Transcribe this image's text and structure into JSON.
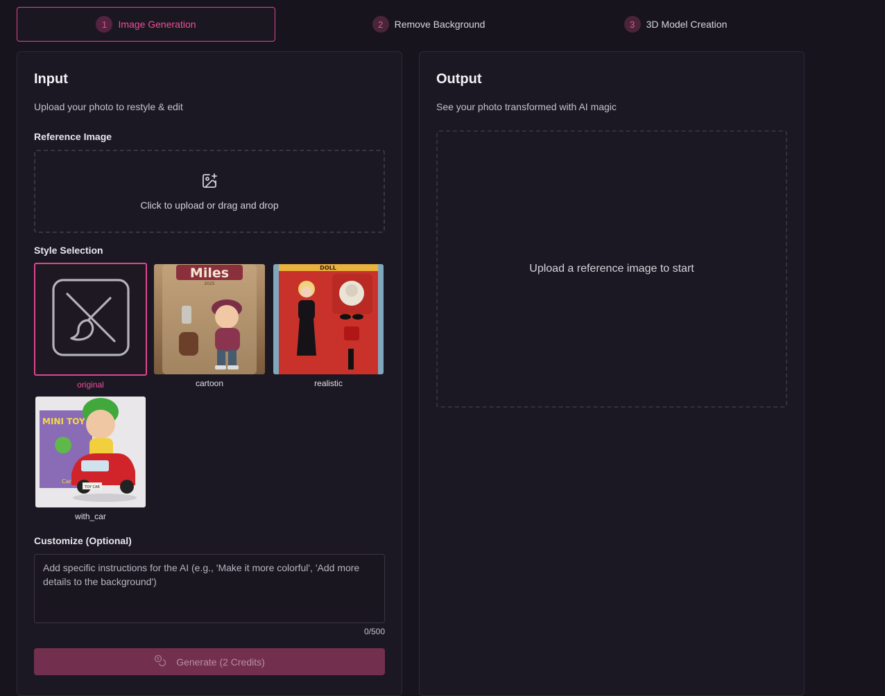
{
  "steps": [
    {
      "num": "1",
      "label": "Image Generation"
    },
    {
      "num": "2",
      "label": "Remove Background"
    },
    {
      "num": "3",
      "label": "3D Model Creation"
    }
  ],
  "input": {
    "title": "Input",
    "subtitle": "Upload your photo to restyle & edit",
    "reference_label": "Reference Image",
    "upload_text": "Click to upload or drag and drop",
    "upload_icon": "image-plus-icon",
    "style_label": "Style Selection",
    "styles": [
      {
        "name": "original",
        "selected": true
      },
      {
        "name": "cartoon",
        "selected": false,
        "box_text": "Miles",
        "box_year": "2025"
      },
      {
        "name": "realistic",
        "selected": false,
        "box_text": "DOLL"
      },
      {
        "name": "with_car",
        "selected": false,
        "box_text": "MINI TOY",
        "box_side": "Car Bu",
        "plate": "TOY CAR"
      }
    ],
    "customize_label": "Customize (Optional)",
    "customize_placeholder": "Add specific instructions for the AI (e.g., 'Make it more colorful', 'Add more details to the background')",
    "counter": "0/500",
    "generate_label": "Generate (2 Credits)",
    "generate_icon": "coins-icon"
  },
  "output": {
    "title": "Output",
    "subtitle": "See your photo transformed with AI magic",
    "placeholder": "Upload a reference image to start"
  },
  "colors": {
    "accent": "#e0458f",
    "background": "#17141d",
    "panel": "#1c1823"
  }
}
